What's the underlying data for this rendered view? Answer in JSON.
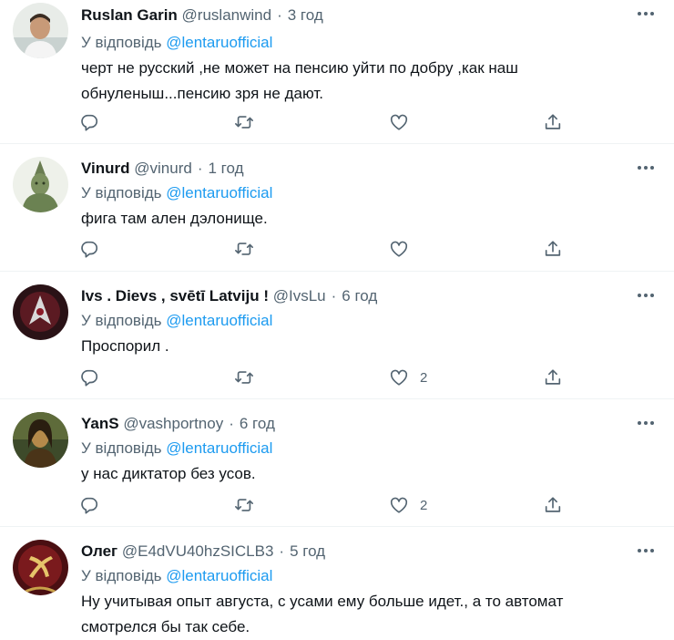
{
  "reply_prefix": "У відповідь",
  "tweets": [
    {
      "name": "Ruslan Garin",
      "handle": "@ruslanwind",
      "separator": "·",
      "time": "3 год",
      "mention": "@lentaruofficial",
      "text": "черт не русский ,не может на пенсию уйти по добру ,как наш обнуленыш...пенсию зря не дают.",
      "likes": ""
    },
    {
      "name": "Vinurd",
      "handle": "@vinurd",
      "separator": "·",
      "time": "1 год",
      "mention": "@lentaruofficial",
      "text": "фига там ален дэлонище.",
      "likes": ""
    },
    {
      "name": "Ivs . Dievs , svētī Latviju !",
      "handle": "@IvsLu",
      "separator": "·",
      "time": "6 год",
      "mention": "@lentaruofficial",
      "text": "Проспорил .",
      "likes": "2"
    },
    {
      "name": "YanS",
      "handle": "@vashportnoy",
      "separator": "·",
      "time": "6 год",
      "mention": "@lentaruofficial",
      "text": "у нас диктатор без усов.",
      "likes": "2"
    },
    {
      "name": "Олег",
      "handle": "@E4dVU40hzSICLB3",
      "separator": "·",
      "time": "5 год",
      "mention": "@lentaruofficial",
      "text": "Ну учитывая опыт августа, с усами ему больше идет., а то автомат смотрелся бы так себе.",
      "likes": ""
    }
  ],
  "icons": {
    "more": "more-icon",
    "reply": "reply-icon",
    "retweet": "retweet-icon",
    "like": "heart-icon",
    "share": "share-icon"
  },
  "colors": {
    "text": "#0f1419",
    "secondary": "#536471",
    "mention": "#1d9bf0",
    "divider": "#eff3f4"
  }
}
